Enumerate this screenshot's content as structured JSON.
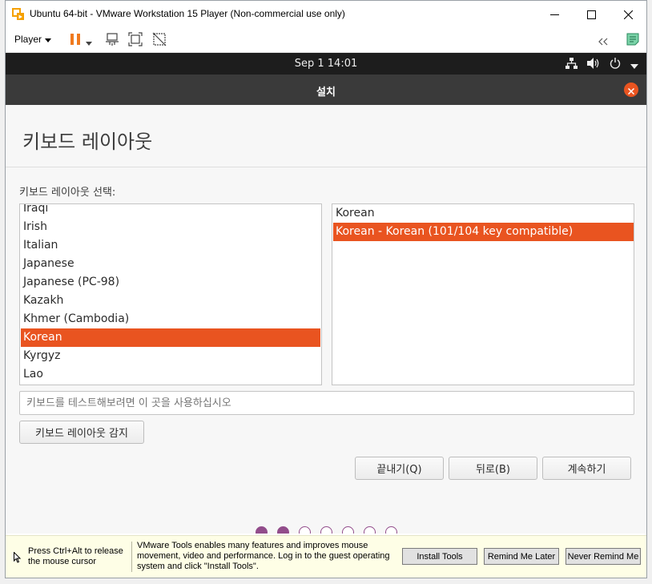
{
  "window": {
    "title": "Ubuntu 64-bit - VMware Workstation 15 Player (Non-commercial use only)",
    "app_icon": "vmware-player-icon",
    "controls": [
      "minimize-icon",
      "maximize-icon",
      "close-icon"
    ]
  },
  "toolbar": {
    "player_menu": "Player",
    "icons": [
      "pause-icon",
      "dropdown-arrow-icon",
      "send-ctrl-alt-del-icon",
      "fit-guest-icon",
      "unity-mode-icon",
      "collapse-icon",
      "vm-notes-icon"
    ]
  },
  "guest_topbar": {
    "clock": "Sep 1  14:01",
    "icons": [
      "network-icon",
      "volume-icon",
      "power-icon",
      "menu-arrow-icon"
    ]
  },
  "installer": {
    "header_title": "설치",
    "page_title": "키보드 레이아웃",
    "select_label": "키보드 레이아웃 선택:",
    "layouts": [
      "Iraqi",
      "Irish",
      "Italian",
      "Japanese",
      "Japanese (PC-98)",
      "Kazakh",
      "Khmer (Cambodia)",
      "Korean",
      "Kyrgyz",
      "Lao"
    ],
    "selected_layout": "Korean",
    "variants": [
      "Korean",
      "Korean - Korean (101/104 key compatible)"
    ],
    "selected_variant": "Korean - Korean (101/104 key compatible)",
    "test_placeholder": "키보드를 테스트해보려면 이 곳을 사용하십시오",
    "detect_button": "키보드 레이아웃 감지",
    "quit_button": "끝내기(Q)",
    "back_button": "뒤로(B)",
    "continue_button": "계속하기",
    "progress": {
      "total_steps": 7,
      "completed_steps": 2
    }
  },
  "notification": {
    "release_text": "Press Ctrl+Alt to release the mouse cursor",
    "tools_text": "VMware Tools enables many features and improves mouse movement, video and performance. Log in to the guest operating system and click \"Install Tools\".",
    "install_button": "Install Tools",
    "remind_button": "Remind Me Later",
    "never_button": "Never Remind Me"
  },
  "colors": {
    "accent": "#e95420",
    "progress_dot": "#924d8b",
    "header_bar": "#3a3a3a",
    "top_bar": "#1d1d1d",
    "notify_bg": "#fefee6"
  }
}
